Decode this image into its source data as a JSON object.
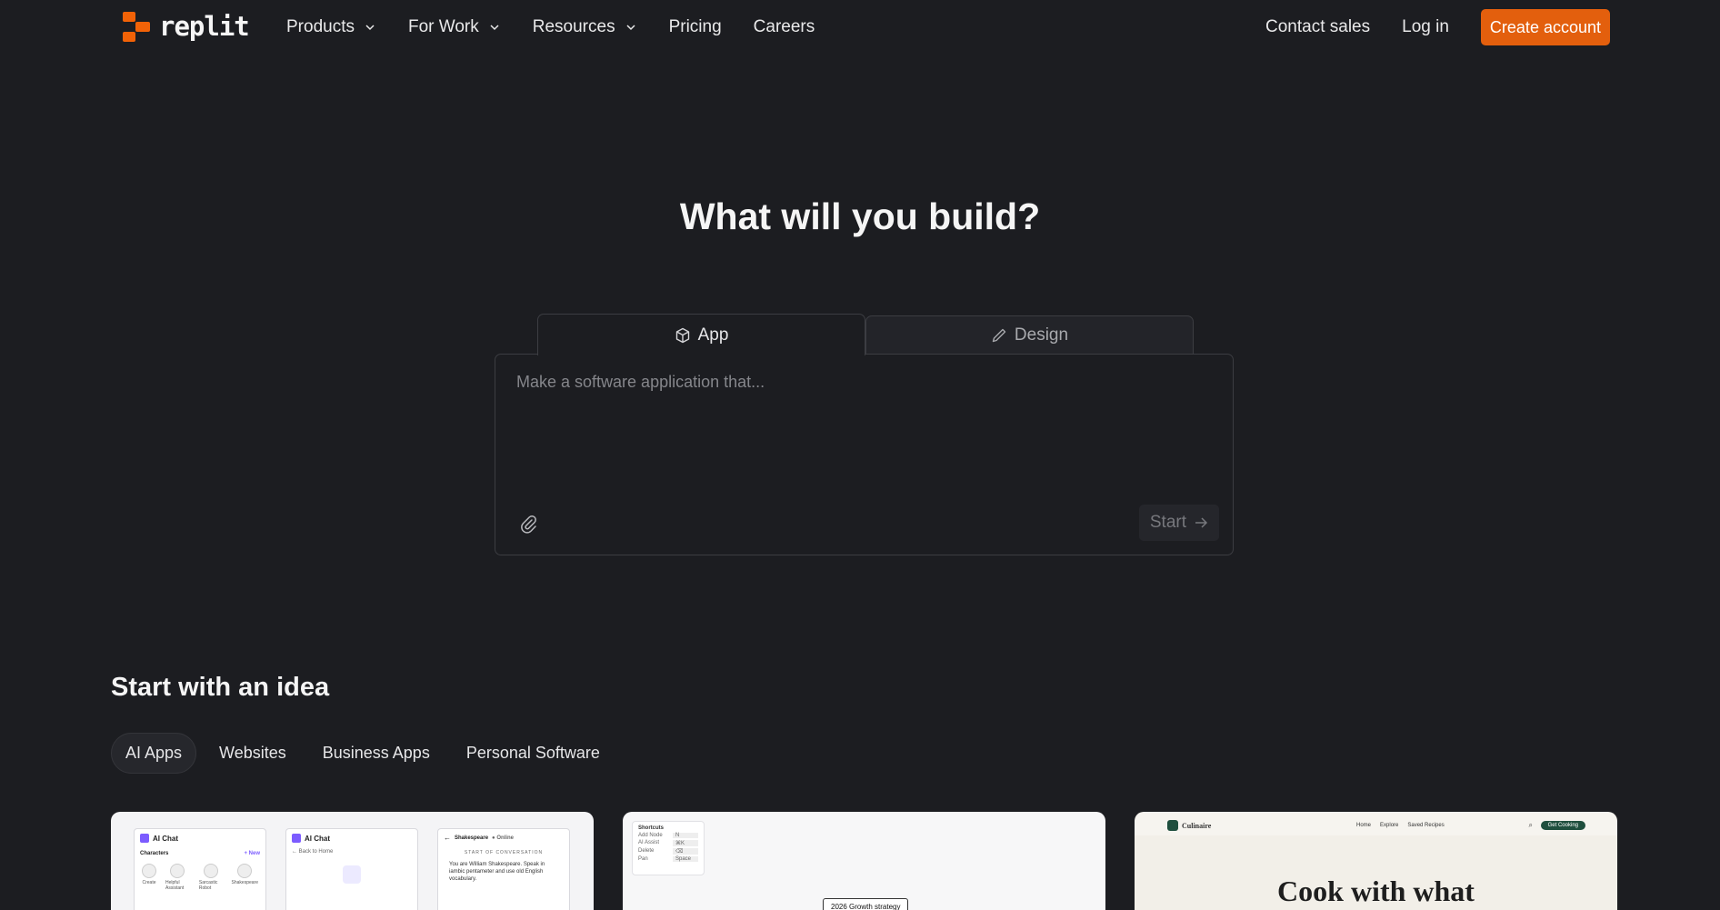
{
  "brand": {
    "name": "replit",
    "accent": "#f26207"
  },
  "nav": {
    "items": [
      {
        "label": "Products",
        "has_dropdown": true
      },
      {
        "label": "For Work",
        "has_dropdown": true
      },
      {
        "label": "Resources",
        "has_dropdown": true
      },
      {
        "label": "Pricing",
        "has_dropdown": false
      },
      {
        "label": "Careers",
        "has_dropdown": false
      }
    ],
    "contact_sales": "Contact sales",
    "log_in": "Log in",
    "create_account": "Create account"
  },
  "hero": {
    "title": "What will you build?",
    "tabs": [
      {
        "label": "App",
        "icon": "cube-icon",
        "active": true
      },
      {
        "label": "Design",
        "icon": "pencil-icon",
        "active": false
      }
    ],
    "prompt_placeholder": "Make a software application that...",
    "start_label": "Start"
  },
  "ideas": {
    "title": "Start with an idea",
    "categories": [
      {
        "label": "AI Apps",
        "active": true
      },
      {
        "label": "Websites",
        "active": false
      },
      {
        "label": "Business Apps",
        "active": false
      },
      {
        "label": "Personal Software",
        "active": false
      }
    ],
    "cards": [
      {
        "app_name": "AI Chat",
        "characters_label": "Characters",
        "new_label": "+ New",
        "characters": [
          "Create",
          "Helpful Assistant",
          "Sarcastic Robot",
          "Shakespeare"
        ],
        "back_label": "← Back to Home",
        "chat_name": "Shakespeare",
        "chat_status": "● Online",
        "conversation_label": "START OF CONVERSATION",
        "message": "You are William Shakespeare. Speak in iambic pentameter and use old English vocabulary."
      },
      {
        "shortcuts_title": "Shortcuts",
        "shortcuts": [
          {
            "action": "Add Node",
            "key": "N"
          },
          {
            "action": "AI Assist",
            "key": "⌘K"
          },
          {
            "action": "Delete",
            "key": "⌫"
          },
          {
            "action": "Pan",
            "key": "Space"
          }
        ],
        "node_label": "2026 Growth strategy"
      },
      {
        "site_name": "Culinaire",
        "links": [
          "Home",
          "Explore",
          "Saved Recipes"
        ],
        "cta": "Get Cooking",
        "headline": "Cook with what"
      }
    ]
  }
}
